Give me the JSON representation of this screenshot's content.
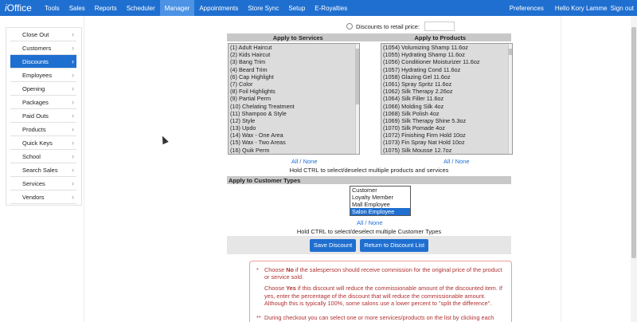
{
  "nav": {
    "brand_prefix": "i",
    "brand_suffix": "Office",
    "items": [
      "Tools",
      "Sales",
      "Reports",
      "Scheduler",
      "Manager",
      "Appointments",
      "Store Sync",
      "Setup",
      "E-Royalties"
    ],
    "active_index": 4,
    "preferences": "Preferences",
    "greeting": "Hello Kory Lamme",
    "sign_out": "Sign out"
  },
  "sidebar": {
    "items": [
      "Close Out",
      "Customers",
      "Discounts",
      "Employees",
      "Opening",
      "Packages",
      "Paid Outs",
      "Products",
      "Quick Keys",
      "School",
      "Search Sales",
      "Services",
      "Vendors"
    ],
    "active_index": 2
  },
  "retail": {
    "label": "Discounts to retail price:"
  },
  "services": {
    "header": "Apply to Services",
    "options": [
      "(1)  Adult Haircut",
      "(2)  Kids Haircut",
      "(3)  Bang Trim",
      "(4)  Beard Trim",
      "(6)  Cap Highlight",
      "(7)  Color",
      "(8)  Foil Highlights",
      "(9)  Partial Perm",
      "(10)  Chelating Treatment",
      "(11)  Shampoo & Style",
      "(12)  Style",
      "(13)  Updo",
      "(14)  Wax - One Area",
      "(15)  Wax - Two Areas",
      "(16)  Quik Perm"
    ],
    "all_none": "All / None"
  },
  "products": {
    "header": "Apply to Products",
    "options": [
      "(1054)  Volumizing Shamp 11.6oz",
      "(1055)  Hydrating Shamp 11.6oz",
      "(1056)  Conditioner Moisturizer 11.6oz",
      "(1057)  Hydrating Cond 11.6oz",
      "(1058)  Glazing Gel 11.6oz",
      "(1061)  Spray Spritz 11.6oz",
      "(1062)  Silk Therapy 2.26oz",
      "(1064)  Silk Filler 11.6oz",
      "(1066)  Molding Silk 4oz",
      "(1068)  Silk Polish 4oz",
      "(1069)  Silk Therapy Shine 5.3oz",
      "(1070)  Silk Pomade 4oz",
      "(1072)  Finishing Firm Hold 10oz",
      "(1073)  Fin Spray Nat Hold 10oz",
      "(1075)  Silk Mousse 12.7oz"
    ],
    "all_none": "All / None"
  },
  "ctrl_note_products": "Hold CTRL to select/deselect multiple products and services",
  "customer_types": {
    "header": "Apply to Customer Types",
    "options": [
      "Customer",
      "Loyalty Member",
      "Mall Employee",
      "Salon Employee"
    ],
    "selected_index": 3,
    "all_none": "All / None",
    "ctrl_note": "Hold CTRL to select/deselect multiple Customer Types"
  },
  "buttons": {
    "save": "Save Discount",
    "return": "Return to Discount List"
  },
  "info": {
    "mark1": "*",
    "p1_a_pre": "Choose ",
    "p1_a_bold": "No",
    "p1_a_post": " if the salesperson should receive commission for the original price of the product or service sold.",
    "p1_b_pre": "Choose ",
    "p1_b_bold": "Yes",
    "p1_b_post": " if this discount will reduce the commissionable amount of the discounted item. If yes, enter the percentage of the discount that will reduce the commissionable amount. Although this is typically 100%, some salons use a lower percent to \"split the difference\".",
    "mark2": "**",
    "p2": "During checkout you can select one or more services/products on the list by clicking each item. When a discounts is added it will be applied to all items selected. If you use a discount set to \"Discount to Retail\" with multiple items selected, it will calculate the discount for each"
  }
}
